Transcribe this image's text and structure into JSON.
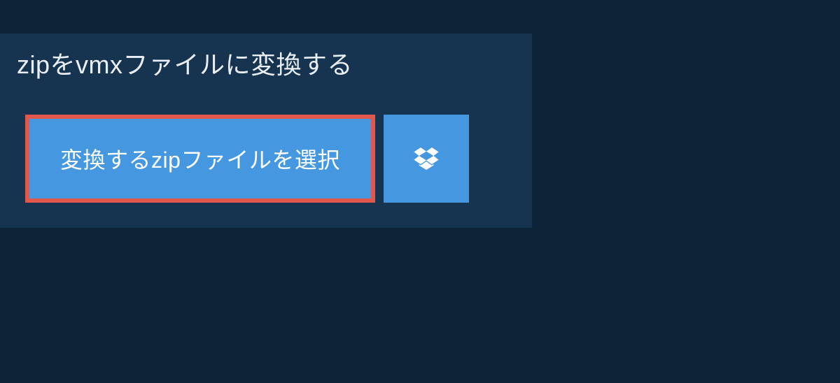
{
  "header": {
    "title": "zipをvmxファイルに変換する"
  },
  "actions": {
    "select_file_label": "変換するzipファイルを選択",
    "dropbox_icon": "dropbox"
  },
  "colors": {
    "background": "#0d2438",
    "panel": "#163450",
    "button_primary": "#4598e0",
    "highlight_border": "#e2574c",
    "text_light": "#e8eef4",
    "text_white": "#ffffff"
  }
}
